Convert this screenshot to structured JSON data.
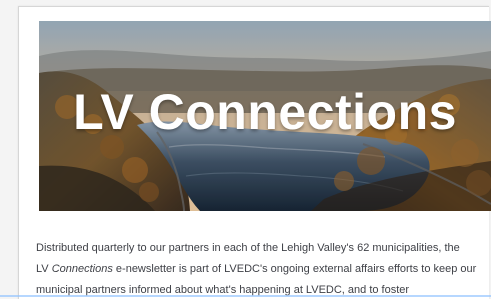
{
  "hero": {
    "title": "LV Connections"
  },
  "intro": {
    "line1": "Distributed quarterly to our partners in each of the Lehigh Valley's 62 municipalities, the",
    "line2_prefix": "LV ",
    "line2_italic": "Connections",
    "line2_suffix": " e-newsletter is part of LVEDC's ongoing external affairs efforts to keep our",
    "line3": "municipal partners informed about what's happening at LVEDC, and to foster"
  },
  "colors": {
    "sky_top": "#b9cad6",
    "sunset": "#e2b37a",
    "river": "#2e3f52",
    "forest_dark": "#3f2f1f",
    "forest_autumn": "#a26b2d",
    "text": "#3f4147"
  }
}
